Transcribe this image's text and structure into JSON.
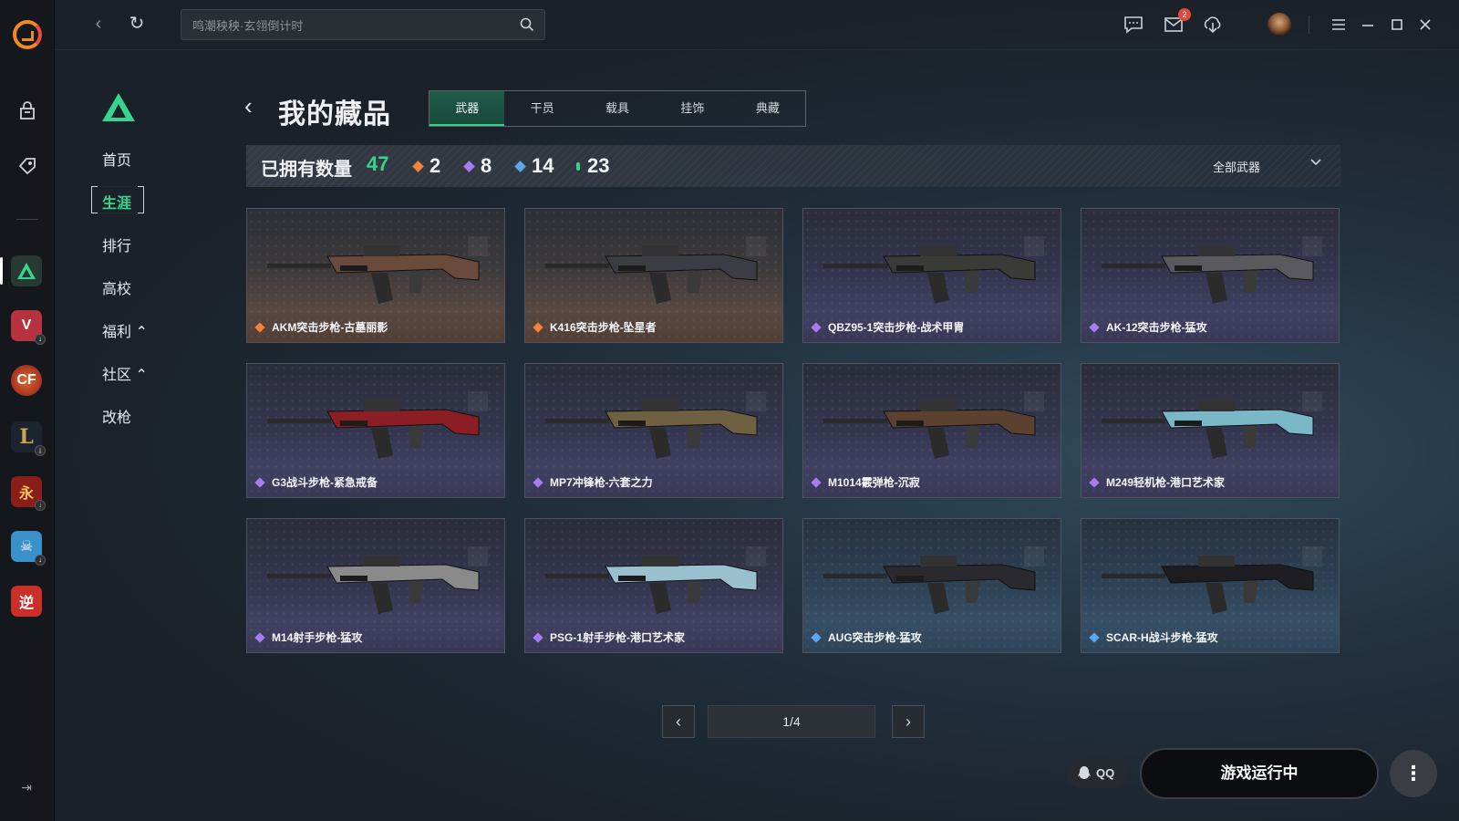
{
  "app": {
    "accent": "#34d58c",
    "brand": "#f28a24"
  },
  "topbar": {
    "search_placeholder": "鸣潮秧秧·玄翎倒计时",
    "mail_badge": "2",
    "icons": [
      "back-arrow-icon",
      "refresh-icon",
      "search-icon",
      "chat-icon",
      "mail-icon",
      "download-icon",
      "menu-icon",
      "minimize-icon",
      "maximize-icon",
      "close-icon"
    ]
  },
  "rail": {
    "icons": [
      "app-logo",
      "bag-icon",
      "tag-icon",
      "delta-force-game",
      "valorant-game",
      "crossfire-game",
      "league-game",
      "ghost-game",
      "skull-game",
      "reverse-game"
    ]
  },
  "sidenav": {
    "items": [
      {
        "label": "首页"
      },
      {
        "label": "生涯"
      },
      {
        "label": "排行"
      },
      {
        "label": "高校"
      },
      {
        "label": "福利 ⌃"
      },
      {
        "label": "社区 ⌃"
      },
      {
        "label": "改枪"
      }
    ],
    "active_index": 1
  },
  "page": {
    "title": "我的藏品",
    "tabs": [
      "武器",
      "干员",
      "载具",
      "挂饰",
      "典藏"
    ],
    "active_tab": 0
  },
  "stats": {
    "owned_label": "已拥有数量",
    "total": "47",
    "rarities": [
      {
        "count": "2",
        "color": "#f0823a"
      },
      {
        "count": "8",
        "color": "#a67cf0"
      },
      {
        "count": "14",
        "color": "#5aa7f0"
      },
      {
        "count": "23",
        "color": "#34d58c"
      }
    ],
    "filter_label": "全部武器"
  },
  "items": [
    {
      "name": "AKM突击步枪-古墓丽影",
      "rarity": "orange"
    },
    {
      "name": "K416突击步枪-坠星者",
      "rarity": "orange"
    },
    {
      "name": "QBZ95-1突击步枪-战术甲胄",
      "rarity": "purple"
    },
    {
      "name": "AK-12突击步枪-猛攻",
      "rarity": "purple"
    },
    {
      "name": "G3战斗步枪-紧急戒备",
      "rarity": "purple"
    },
    {
      "name": "MP7冲锋枪-六套之力",
      "rarity": "purple"
    },
    {
      "name": "M1014霰弹枪-沉寂",
      "rarity": "purple"
    },
    {
      "name": "M249轻机枪-港口艺术家",
      "rarity": "purple"
    },
    {
      "name": "M14射手步枪-猛攻",
      "rarity": "purple"
    },
    {
      "name": "PSG-1射手步枪-港口艺术家",
      "rarity": "purple"
    },
    {
      "name": "AUG突击步枪-猛攻",
      "rarity": "blue"
    },
    {
      "name": "SCAR-H战斗步枪-猛攻",
      "rarity": "blue"
    }
  ],
  "pagination": {
    "text": "1/4"
  },
  "footer": {
    "qq_label": "QQ",
    "run_label": "游戏运行中",
    "more_label": "⋮"
  }
}
